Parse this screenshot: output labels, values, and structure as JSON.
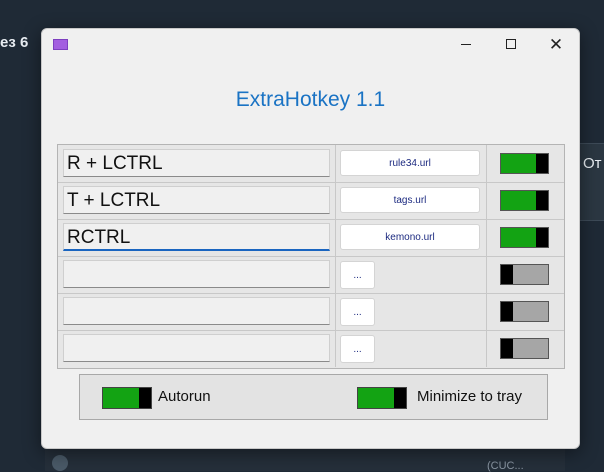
{
  "background": {
    "left_fragment": "ез 6",
    "right_fragment": "От",
    "bottom_fragment": "(CUC..."
  },
  "window": {
    "title": "",
    "app_title": "ExtraHotkey 1.1"
  },
  "hotkeys": [
    {
      "key": "R + LCTRL",
      "url": "rule34.url",
      "enabled": true
    },
    {
      "key": "T + LCTRL",
      "url": "tags.url",
      "enabled": true
    },
    {
      "key": "RCTRL",
      "url": "kemono.url",
      "enabled": true
    },
    {
      "key": "",
      "url": "...",
      "enabled": false
    },
    {
      "key": "",
      "url": "...",
      "enabled": false
    },
    {
      "key": "",
      "url": "...",
      "enabled": false
    }
  ],
  "options": {
    "autorun_label": "Autorun",
    "autorun_enabled": true,
    "tray_label": "Minimize to tray",
    "tray_enabled": true
  },
  "colors": {
    "accent_title": "#1a73c4",
    "toggle_on": "#13a313",
    "toggle_off": "#a6a6a6"
  }
}
